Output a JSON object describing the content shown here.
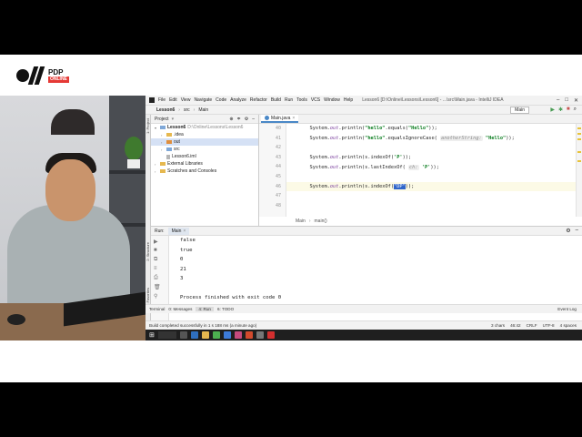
{
  "brand": {
    "name": "PDP",
    "sub": "ONLINE"
  },
  "window": {
    "menu": [
      "File",
      "Edit",
      "View",
      "Navigate",
      "Code",
      "Analyze",
      "Refactor",
      "Build",
      "Run",
      "Tools",
      "VCS",
      "Window",
      "Help"
    ],
    "title": "Lesson6 [D:\\Online\\Lessons\\Lesson6] - ...\\src\\Main.java - IntelliJ IDEA"
  },
  "nav": {
    "breadcrumb": [
      "Lesson6",
      "src",
      "Main"
    ],
    "run_config": "Main"
  },
  "project": {
    "header": "Project",
    "tree": [
      {
        "label": "Lesson6",
        "extra": "D:\\Online\\Lessons\\Lesson6",
        "level": 0,
        "type": "folder-blue",
        "expanded": true,
        "bold": true
      },
      {
        "label": ".idea",
        "extra": "",
        "level": 1,
        "type": "folder",
        "expanded": false
      },
      {
        "label": "out",
        "extra": "",
        "level": 1,
        "type": "folder-orange",
        "expanded": false,
        "selected": true
      },
      {
        "label": "src",
        "extra": "",
        "level": 1,
        "type": "folder-blue",
        "expanded": false
      },
      {
        "label": "Lesson6.iml",
        "extra": "",
        "level": 1,
        "type": "file"
      },
      {
        "label": "External Libraries",
        "extra": "",
        "level": 0,
        "type": "folder",
        "expanded": false
      },
      {
        "label": "Scratches and Consoles",
        "extra": "",
        "level": 0,
        "type": "folder"
      }
    ]
  },
  "editor": {
    "tab": "Main.java",
    "breadcrumb": [
      "Main",
      "main()"
    ],
    "line_numbers": [
      "40",
      "41",
      "42",
      "43",
      "44",
      "45",
      "46",
      "47",
      "48"
    ],
    "lines": [
      {
        "parts": [
          {
            "t": "        System."
          },
          {
            "t": "out",
            "c": "f"
          },
          {
            "t": ".println("
          },
          {
            "t": "\"hello\"",
            "c": "s"
          },
          {
            "t": ".equals("
          },
          {
            "t": "\"Hello\"",
            "c": "s"
          },
          {
            "t": "));"
          }
        ]
      },
      {
        "parts": [
          {
            "t": "        System."
          },
          {
            "t": "out",
            "c": "f"
          },
          {
            "t": ".println("
          },
          {
            "t": "\"hello\"",
            "c": "s"
          },
          {
            "t": ".equalsIgnoreCase( "
          },
          {
            "t": "anotherString:",
            "c": "hint"
          },
          {
            "t": " "
          },
          {
            "t": "\"Hello\"",
            "c": "s"
          },
          {
            "t": "));"
          }
        ]
      },
      {
        "parts": [
          {
            "t": ""
          }
        ]
      },
      {
        "parts": [
          {
            "t": "        System."
          },
          {
            "t": "out",
            "c": "f"
          },
          {
            "t": ".println(s.indexOf("
          },
          {
            "t": "'P'",
            "c": "s"
          },
          {
            "t": "));"
          }
        ]
      },
      {
        "parts": [
          {
            "t": "        System."
          },
          {
            "t": "out",
            "c": "f"
          },
          {
            "t": ".println(s.lastIndexOf( "
          },
          {
            "t": "ch:",
            "c": "hint"
          },
          {
            "t": " "
          },
          {
            "t": "'P'",
            "c": "s"
          },
          {
            "t": "));"
          }
        ]
      },
      {
        "parts": [
          {
            "t": ""
          }
        ]
      },
      {
        "parts": [
          {
            "t": "        System."
          },
          {
            "t": "out",
            "c": "f"
          },
          {
            "t": ".println(s.indexOf("
          },
          {
            "t": "\"DP\"",
            "c": "sel-text"
          },
          {
            "t": "));"
          }
        ],
        "highlight": true
      },
      {
        "parts": [
          {
            "t": ""
          }
        ]
      },
      {
        "parts": [
          {
            "t": ""
          }
        ]
      }
    ]
  },
  "run": {
    "label": "Run:",
    "tab": "Main",
    "output": [
      "false",
      "true",
      "0",
      "21",
      "3",
      "",
      "Process finished with exit code 0"
    ],
    "footer": [
      "Terminal",
      "0: Messages",
      "4: Run",
      "6: TODO"
    ],
    "event_log": "Event Log"
  },
  "status": {
    "message": "Build completed successfully in 1 s 188 ms (a minute ago)",
    "right": [
      "3 chars",
      "46:42",
      "CRLF",
      "UTF-8",
      "4 spaces"
    ]
  },
  "left_strip": [
    "1: Project",
    "2: Structure",
    "2: Favorites"
  ],
  "colors": {
    "accent": "#4a88c7",
    "string": "#0a7d1f",
    "field": "#7a3e9d",
    "selection": "#2f65ca"
  }
}
